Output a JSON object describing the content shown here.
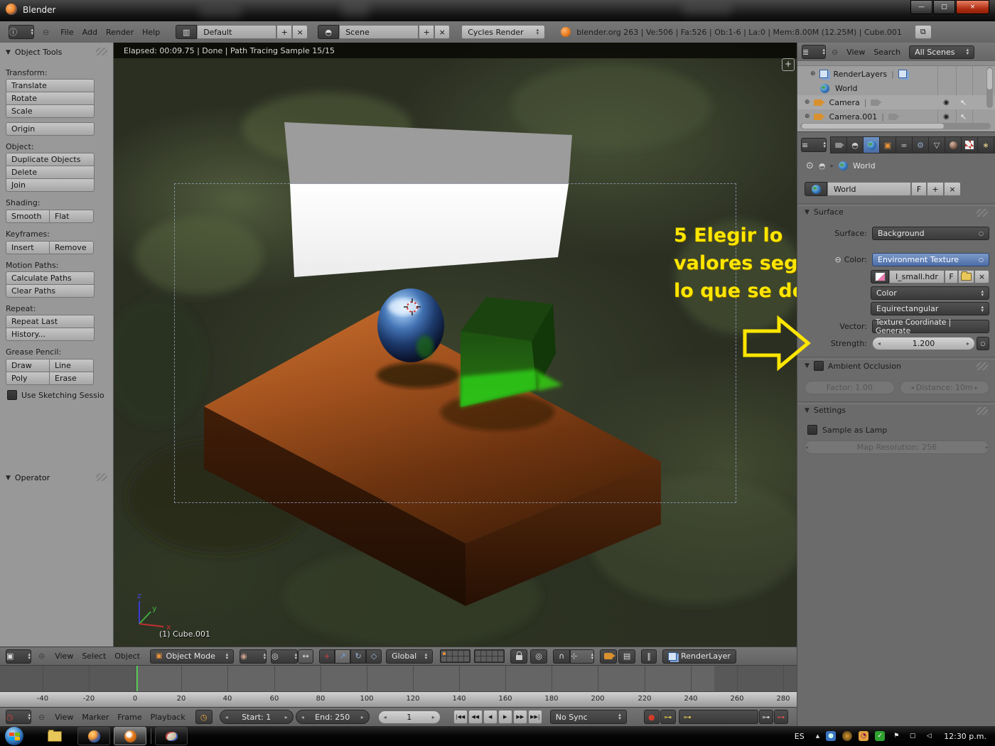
{
  "window": {
    "title": "Blender"
  },
  "icons": {
    "info": "ⓘ",
    "minus_circle": "⊖",
    "plus": "+",
    "close": "×",
    "f": "F",
    "dropdown_circle": "○",
    "grid_layout": "▥",
    "scene_ball": "◓",
    "cube": "▣",
    "shading_sphere": "◉",
    "pivot": "◎",
    "toggle_width": "↔",
    "manip_axis": "+",
    "manip_translate": "↗",
    "manip_rotate": "↻",
    "manip_scale": "◇",
    "proportional": "◎",
    "magnet": "∩",
    "snap_target": "⊹",
    "clapper": "▤",
    "pause": "‖",
    "renderlayer": "❏",
    "clock": "◷",
    "record": "●",
    "key": "⊶",
    "key_x": "⊶",
    "playback": [
      "|◀◀",
      "◀◀",
      "◀",
      "▶",
      "▶▶",
      "▶▶|"
    ],
    "expand": "⊕",
    "eye": "◉",
    "cursor_arrow": "↖",
    "constraints": "∞",
    "modifiers": "⚙",
    "data_triangle": "▽",
    "particles": "∗",
    "physics_partial": "◠",
    "pin": "⊙",
    "breadcrumb_arrow": "▸",
    "window_popout": "⧉",
    "list": "≣",
    "properties_list": "≡",
    "minimize": "—",
    "maximize": "▢",
    "close_win": "×",
    "tray_up": "▲",
    "axis_plus": "+"
  },
  "menubar": {
    "items": [
      "File",
      "Add",
      "Render",
      "Help"
    ],
    "layout": "Default",
    "scene_name": "Scene",
    "engine": "Cycles Render",
    "stats": "blender.org 263 | Ve:506 | Fa:526 | Ob:1-6 | La:0 | Mem:8.00M (12.25M) | Cube.001"
  },
  "toolshelf": {
    "title": "Object Tools",
    "transform_label": "Transform:",
    "translate": "Translate",
    "rotate": "Rotate",
    "scale": "Scale",
    "origin": "Origin",
    "object_label": "Object:",
    "duplicate": "Duplicate Objects",
    "delete": "Delete",
    "join": "Join",
    "shading_label": "Shading:",
    "smooth": "Smooth",
    "flat": "Flat",
    "keyframes_label": "Keyframes:",
    "insert": "Insert",
    "remove": "Remove",
    "motion_label": "Motion Paths:",
    "calculate_paths": "Calculate Paths",
    "clear_paths": "Clear Paths",
    "repeat_label": "Repeat:",
    "repeat_last": "Repeat Last",
    "history": "History...",
    "grease_label": "Grease Pencil:",
    "draw": "Draw",
    "line": "Line",
    "poly": "Poly",
    "erase": "Erase",
    "sketching": "Use Sketching Sessio",
    "operator_title": "Operator"
  },
  "viewport": {
    "render_status": "Elapsed: 00:09.75 | Done | Path Tracing Sample 15/15",
    "active_object": "(1) Cube.001",
    "axis": {
      "x": "x",
      "y": "y",
      "z": "z"
    },
    "annotation_line1": "5 Elegir lo",
    "annotation_line2": "valores segun",
    "annotation_line3": "lo que se desee!",
    "annotation_color": "#ffe600"
  },
  "viewport_header": {
    "menus": [
      "View",
      "Select",
      "Object"
    ],
    "mode": "Object Mode",
    "orientation": "Global",
    "render_layer": "RenderLayer"
  },
  "timeline": {
    "ticks": [
      "-40",
      "-20",
      "0",
      "20",
      "40",
      "60",
      "80",
      "100",
      "120",
      "140",
      "160",
      "180",
      "200",
      "220",
      "240",
      "260",
      "280"
    ],
    "header": {
      "menus": [
        "View",
        "Marker",
        "Frame",
        "Playback"
      ],
      "start": "Start: 1",
      "end": "End: 250",
      "current": "1",
      "sync": "No Sync"
    }
  },
  "outliner": {
    "menus": [
      "View",
      "Search"
    ],
    "filter": "All Scenes",
    "rows": [
      {
        "label": "RenderLayers"
      },
      {
        "label": "World"
      },
      {
        "label": "Camera"
      },
      {
        "label": "Camera.001"
      }
    ]
  },
  "properties": {
    "breadcrumb_world": "World",
    "world_name": "World",
    "surface_title": "Surface",
    "surface_label": "Surface:",
    "surface_value": "Background",
    "color_label": "Color:",
    "color_value": "Environment Texture",
    "image_name": "l_small.hdr",
    "color_space": "Color",
    "projection": "Equirectangular",
    "vector_label": "Vector:",
    "vector_value": "Texture Coordinate | Generate",
    "strength_label": "Strength:",
    "strength_value": "1.200",
    "ao_title": "Ambient Occlusion",
    "ao_factor": "Factor: 1.00",
    "ao_distance": "Distance: 10m",
    "settings_title": "Settings",
    "sample_as_lamp": "Sample as Lamp",
    "map_resolution": "Map Resolution: 256",
    "accent_blue": "#5a7cb5"
  },
  "taskbar": {
    "language": "ES",
    "clock": "12:30 p.m."
  }
}
